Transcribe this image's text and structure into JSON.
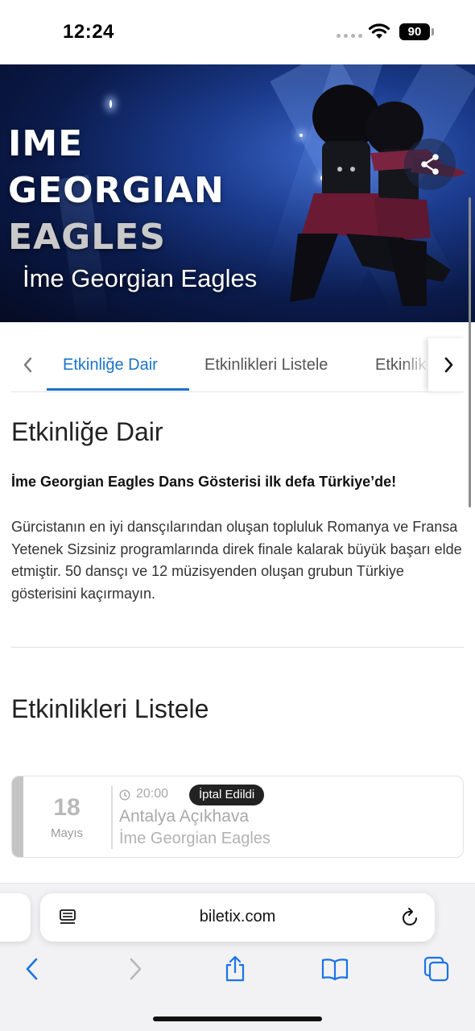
{
  "status_bar": {
    "time": "12:24",
    "battery": "90",
    "icons": [
      "signal-dots-icon",
      "wifi-icon",
      "battery-icon"
    ]
  },
  "hero": {
    "logo_lines": [
      "IME",
      "GEORGIAN",
      "EAGLES"
    ],
    "title": "İme Georgian Eagles",
    "share_icon": "share-icon"
  },
  "tabs": {
    "items": [
      "Etkinliğe Dair",
      "Etkinlikleri Listele",
      "Etkinlik"
    ],
    "active_index": 0,
    "prev_icon": "chevron-left-icon",
    "next_icon": "chevron-right-icon"
  },
  "about": {
    "heading": "Etkinliğe Dair",
    "lead": "İme Georgian Eagles Dans Gösterisi ilk defa Türkiye’de!",
    "body": "Gürcistanın en iyi dansçılarından oluşan topluluk Romanya ve Fransa Yetenek Sizsiniz programlarında direk finale kalarak büyük başarı elde etmiştir. 50 dansçı ve 12 müzisyenden oluşan grubun Türkiye gösterisini kaçırmayın."
  },
  "events": {
    "heading": "Etkinlikleri Listele",
    "items": [
      {
        "day": "18",
        "month": "Mayıs",
        "time": "20:00",
        "status": "İptal Edildi",
        "venue": "Antalya Açıkhava",
        "name": "İme Georgian Eagles"
      }
    ]
  },
  "browser": {
    "url": "biletix.com",
    "icons": [
      "page-menu-icon",
      "reload-icon",
      "back-icon",
      "forward-icon",
      "share-icon",
      "bookmarks-icon",
      "tabs-icon"
    ]
  },
  "colors": {
    "accent": "#1a73c8",
    "badge": "#222222",
    "muted": "#a9a9a9"
  }
}
